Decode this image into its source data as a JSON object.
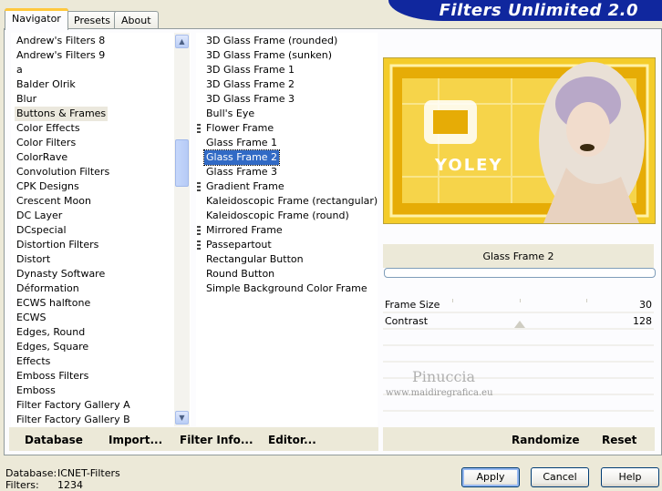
{
  "tabs": [
    "Navigator",
    "Presets",
    "About"
  ],
  "logo": "Filters Unlimited 2.0",
  "categories": [
    "Andrew's Filters 8",
    "Andrew's Filters 9",
    "a",
    "Balder Olrik",
    "Blur",
    "Buttons & Frames",
    "Color Effects",
    "Color Filters",
    "ColorRave",
    "Convolution Filters",
    "CPK Designs",
    "Crescent Moon",
    "DC Layer",
    "DCspecial",
    "Distortion Filters",
    "Distort",
    "Dynasty Software",
    "Déformation",
    "ECWS halftone",
    "ECWS",
    "Edges, Round",
    "Edges, Square",
    "Effects",
    "Emboss Filters",
    "Emboss",
    "Filter Factory Gallery A",
    "Filter Factory Gallery B"
  ],
  "selected_category": "Buttons & Frames",
  "filters": [
    {
      "label": "3D Glass Frame (rounded)",
      "sub": false
    },
    {
      "label": "3D Glass Frame (sunken)",
      "sub": false
    },
    {
      "label": "3D Glass Frame 1",
      "sub": false
    },
    {
      "label": "3D Glass Frame 2",
      "sub": false
    },
    {
      "label": "3D Glass Frame 3",
      "sub": false
    },
    {
      "label": "Bull's Eye",
      "sub": false
    },
    {
      "label": "Flower Frame",
      "sub": true
    },
    {
      "label": "Glass Frame 1",
      "sub": false
    },
    {
      "label": "Glass Frame 2",
      "sub": false
    },
    {
      "label": "Glass Frame 3",
      "sub": false
    },
    {
      "label": "Gradient Frame",
      "sub": true
    },
    {
      "label": "Kaleidoscopic Frame (rectangular)",
      "sub": false
    },
    {
      "label": "Kaleidoscopic Frame (round)",
      "sub": false
    },
    {
      "label": "Mirrored Frame",
      "sub": true
    },
    {
      "label": "Passepartout",
      "sub": true
    },
    {
      "label": "Rectangular Button",
      "sub": false
    },
    {
      "label": "Round Button",
      "sub": false
    },
    {
      "label": "Simple Background Color Frame",
      "sub": false
    }
  ],
  "selected_filter": "Glass Frame 2",
  "preview": {
    "filter_name": "Glass Frame 2",
    "wordmark": "YOLEY"
  },
  "params": [
    {
      "name": "Frame Size",
      "value": "30"
    },
    {
      "name": "Contrast",
      "value": "128"
    }
  ],
  "watermark": {
    "name": "Pinuccia",
    "url": "www.maidiregrafica.eu"
  },
  "bottom_left_buttons": {
    "database": "Database",
    "import": "Import...",
    "filter_info": "Filter Info...",
    "editor": "Editor..."
  },
  "bottom_right_buttons": {
    "randomize": "Randomize",
    "reset": "Reset"
  },
  "status": {
    "database_label": "Database:",
    "database_value": "ICNET-Filters",
    "filters_label": "Filters:",
    "filters_value": "1234"
  },
  "dialog_buttons": {
    "apply": "Apply",
    "cancel": "Cancel",
    "help": "Help"
  },
  "colors": {
    "selection": "#316ac5",
    "logo_bg": "#10279e",
    "frame_gold": "#e8b400"
  },
  "icons": {
    "scroll_up": "chevron-up-icon",
    "scroll_down": "chevron-down-icon"
  }
}
